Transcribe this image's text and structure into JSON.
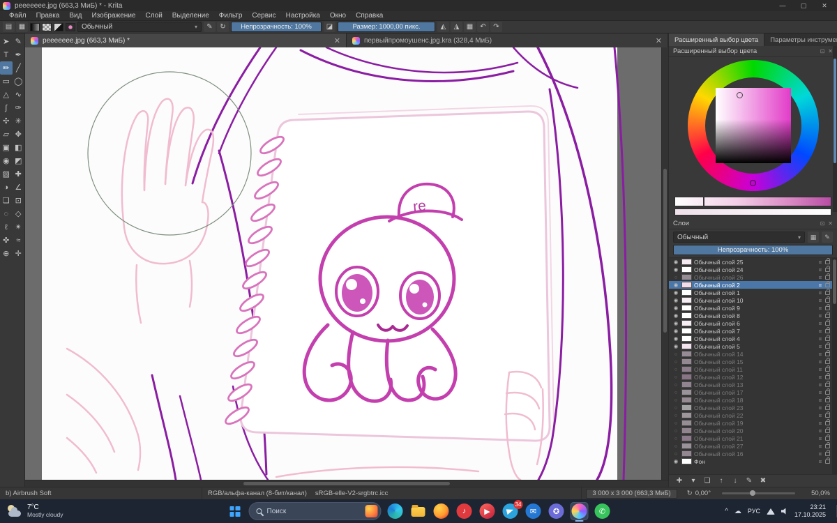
{
  "window": {
    "title": "peeeeeee.jpg (663,3 МиБ) * - Krita",
    "minimize": "—",
    "maximize": "▢",
    "close": "✕"
  },
  "menubar": {
    "items": [
      "Файл",
      "Правка",
      "Вид",
      "Изображение",
      "Слой",
      "Выделение",
      "Фильтр",
      "Сервис",
      "Настройка",
      "Окно",
      "Справка"
    ]
  },
  "toolbar": {
    "file_icons": [
      {
        "n": "new-document-icon",
        "g": "▤"
      },
      {
        "n": "workspace-chooser-icon",
        "g": "▦"
      }
    ],
    "blend_mode": "Обычный",
    "caret": "▾",
    "preset_icons": [
      {
        "n": "edit-brush-settings-icon",
        "g": "✎"
      },
      {
        "n": "reload-preset-icon",
        "g": "↻"
      }
    ],
    "opacity_label": "Непрозрачность: 100%",
    "eraser_icon": "◪",
    "size_label": "Размер: 1000,00 пикс.",
    "right_icons": [
      {
        "n": "horizontal-mirror-icon",
        "g": "◭"
      },
      {
        "n": "vertical-mirror-icon",
        "g": "◮"
      },
      {
        "n": "wrap-around-mode-icon",
        "g": "▦"
      },
      {
        "n": "undo-icon",
        "g": "↶"
      },
      {
        "n": "redo-icon",
        "g": "↷"
      }
    ]
  },
  "toolbox": {
    "tools": [
      {
        "n": "select-shapes-tool",
        "g": "➤"
      },
      {
        "n": "edit-shapes-tool",
        "g": "✎"
      },
      {
        "n": "text-tool",
        "g": "T"
      },
      {
        "n": "calligraphy-tool",
        "g": "✒"
      },
      {
        "n": "freehand-brush-tool",
        "g": "✏",
        "active": true
      },
      {
        "n": "line-tool",
        "g": "╱"
      },
      {
        "n": "rectangle-tool",
        "g": "▭"
      },
      {
        "n": "ellipse-tool",
        "g": "◯"
      },
      {
        "n": "polygon-tool",
        "g": "△"
      },
      {
        "n": "polyline-tool",
        "g": "∿"
      },
      {
        "n": "bezier-curve-tool",
        "g": "ʃ"
      },
      {
        "n": "freehand-path-tool",
        "g": "✑"
      },
      {
        "n": "dynamic-brush-tool",
        "g": "✣"
      },
      {
        "n": "multibrush-tool",
        "g": "✳"
      },
      {
        "n": "transform-tool",
        "g": "▱"
      },
      {
        "n": "move-tool",
        "g": "✥"
      },
      {
        "n": "crop-tool",
        "g": "▣"
      },
      {
        "n": "gradient-tool",
        "g": "◧"
      },
      {
        "n": "color-sampler-tool",
        "g": "◉"
      },
      {
        "n": "fill-tool",
        "g": "◩"
      },
      {
        "n": "pattern-edit-tool",
        "g": "▨"
      },
      {
        "n": "smart-patch-tool",
        "g": "✚"
      },
      {
        "n": "colorize-mask-tool",
        "g": "◑"
      },
      {
        "n": "measure-tool",
        "g": "∠"
      },
      {
        "n": "reference-images-tool",
        "g": "❏"
      },
      {
        "n": "rect-select-tool",
        "g": "⊡"
      },
      {
        "n": "ellipse-select-tool",
        "g": "◌"
      },
      {
        "n": "polygon-select-tool",
        "g": "◇"
      },
      {
        "n": "freehand-select-tool",
        "g": "ℓ"
      },
      {
        "n": "similar-color-select-tool",
        "g": "✴"
      },
      {
        "n": "bezier-select-tool",
        "g": "✜"
      },
      {
        "n": "magnetic-select-tool",
        "g": "≈"
      },
      {
        "n": "zoom-tool",
        "g": "⊕"
      },
      {
        "n": "pan-tool",
        "g": "✛"
      }
    ]
  },
  "doc_tabs": [
    {
      "label": "peeeeeee.jpg (663,3 МиБ) *",
      "close": "✕",
      "active": true
    },
    {
      "label": "первыйпромоушенс.jpg.kra (328,4 МиБ)",
      "close": "✕"
    }
  ],
  "artwork": {
    "cap_text": "re"
  },
  "right_panel": {
    "dock_tabs": [
      {
        "label": "Расширенный выбор цвета",
        "active": true
      },
      {
        "label": "Параметры инструмента"
      }
    ],
    "color_docker": {
      "title": "Расширенный выбор цвета",
      "float_icon": "⊡",
      "close_icon": "✕"
    },
    "layers": {
      "title": "Слои",
      "float_icon": "⊡",
      "close_icon": "✕",
      "blend_mode": "Обычный",
      "caret": "▾",
      "alpha_icon": "α",
      "opacity_label": "Непрозрачность: 100%",
      "buttons": [
        {
          "n": "add-layer-button",
          "g": "✚"
        },
        {
          "n": "add-layer-caret",
          "g": "▾"
        },
        {
          "n": "duplicate-layer-button",
          "g": "❏"
        },
        {
          "n": "move-layer-up-button",
          "g": "↑"
        },
        {
          "n": "move-layer-down-button",
          "g": "↓"
        },
        {
          "n": "layer-properties-button",
          "g": "✎"
        },
        {
          "n": "delete-layer-button",
          "g": "✖"
        }
      ],
      "items": [
        {
          "name": "Обычный слой 25",
          "eye": "◉",
          "thumb": "#f5e9f2"
        },
        {
          "name": "Обычный слой 24",
          "eye": "◉",
          "thumb": "#ffffff"
        },
        {
          "name": "Обычный слой 26",
          "eye": "○",
          "dim": true,
          "thumb": "#e7d7e4"
        },
        {
          "name": "Обычный слой 2",
          "eye": "◉",
          "selected": true,
          "thumb": "#f0dceb"
        },
        {
          "name": "Обычный слой 1",
          "eye": "◉",
          "thumb": "#ffffff"
        },
        {
          "name": "Обычный слой 10",
          "eye": "◉",
          "thumb": "#f7eef5"
        },
        {
          "name": "Обычный слой 9",
          "eye": "◉",
          "thumb": "#ffffff"
        },
        {
          "name": "Обычный слой 8",
          "eye": "◉",
          "thumb": "#ffffff"
        },
        {
          "name": "Обычный слой 6",
          "eye": "◉",
          "thumb": "#f7eef5"
        },
        {
          "name": "Обычный слой 7",
          "eye": "◉",
          "thumb": "#ffffff"
        },
        {
          "name": "Обычный слой 4",
          "eye": "◉",
          "thumb": "#ffffff"
        },
        {
          "name": "Обычный слой 5",
          "eye": "◉",
          "thumb": "#f2e3ee"
        },
        {
          "name": "Обычный слой 14",
          "eye": "○",
          "dim": true,
          "thumb": "#e9d5e6"
        },
        {
          "name": "Обычный слой 15",
          "eye": "○",
          "dim": true,
          "thumb": "#e4cfe1"
        },
        {
          "name": "Обычный слой 11",
          "eye": "○",
          "dim": true,
          "thumb": "#d9b9d4"
        },
        {
          "name": "Обычный слой 12",
          "eye": "○",
          "dim": true,
          "thumb": "#cfa9c9"
        },
        {
          "name": "Обычный слой 13",
          "eye": "○",
          "dim": true,
          "thumb": "#e0c4dc"
        },
        {
          "name": "Обычный слой 17",
          "eye": "○",
          "dim": true,
          "thumb": "#efe2ec"
        },
        {
          "name": "Обычный слой 18",
          "eye": "○",
          "dim": true,
          "thumb": "#e6d2e2"
        },
        {
          "name": "Обычный слой 23",
          "eye": "○",
          "dim": true,
          "thumb": "#ffffff"
        },
        {
          "name": "Обычный слой 22",
          "eye": "○",
          "dim": true,
          "thumb": "#f4e8f1"
        },
        {
          "name": "Обычный слой 19",
          "eye": "○",
          "dim": true,
          "thumb": "#e8d6e5"
        },
        {
          "name": "Обычный слой 20",
          "eye": "○",
          "dim": true,
          "thumb": "#dfc6db"
        },
        {
          "name": "Обычный слой 21",
          "eye": "○",
          "dim": true,
          "thumb": "#d5b3cf"
        },
        {
          "name": "Обычный слой 27",
          "eye": "○",
          "dim": true,
          "thumb": "#eddfea"
        },
        {
          "name": "Обычный слой 16",
          "eye": "○",
          "dim": true,
          "thumb": "#e2cbde"
        },
        {
          "name": "Фон",
          "eye": "◉",
          "thumb": "#ffffff"
        }
      ]
    }
  },
  "statusbar": {
    "brush_name": "b) Airbrush Soft",
    "color_mode": "RGB/альфа-канал (8-бит/канал)",
    "icc_profile": "sRGB-elle-V2-srgbtrc.icc",
    "dimensions": "3 000 x 3 000 (663,3 МиБ)",
    "rotation_reset_icon": "↻",
    "angle": "0,00°",
    "zoom": "50,0%"
  },
  "taskbar": {
    "weather": {
      "temp": "7°C",
      "condition": "Mostly cloudy"
    },
    "search_label": "Поиск",
    "apps": [
      {
        "n": "edge-icon",
        "style": "edge"
      },
      {
        "n": "file-explorer-icon",
        "style": "folder"
      },
      {
        "n": "firefox-icon",
        "style": "firefox"
      },
      {
        "n": "music-app-icon",
        "style": "red",
        "g": "♪"
      },
      {
        "n": "media-app-icon",
        "style": "maroon",
        "g": "▶"
      },
      {
        "n": "telegram-icon",
        "style": "telegram",
        "badge": "34"
      },
      {
        "n": "mail-app-icon",
        "style": "blue",
        "g": "✉"
      },
      {
        "n": "discord-icon",
        "style": "purple",
        "g": "✪"
      },
      {
        "n": "krita-taskbar-icon",
        "style": "krita",
        "active": true
      },
      {
        "n": "whatsapp-icon",
        "style": "green",
        "g": "✆"
      }
    ],
    "tray": {
      "chevron": "^",
      "cloud_icon": "☁",
      "language": "РУС",
      "time": "23:21",
      "date": "17.10.2025"
    }
  }
}
